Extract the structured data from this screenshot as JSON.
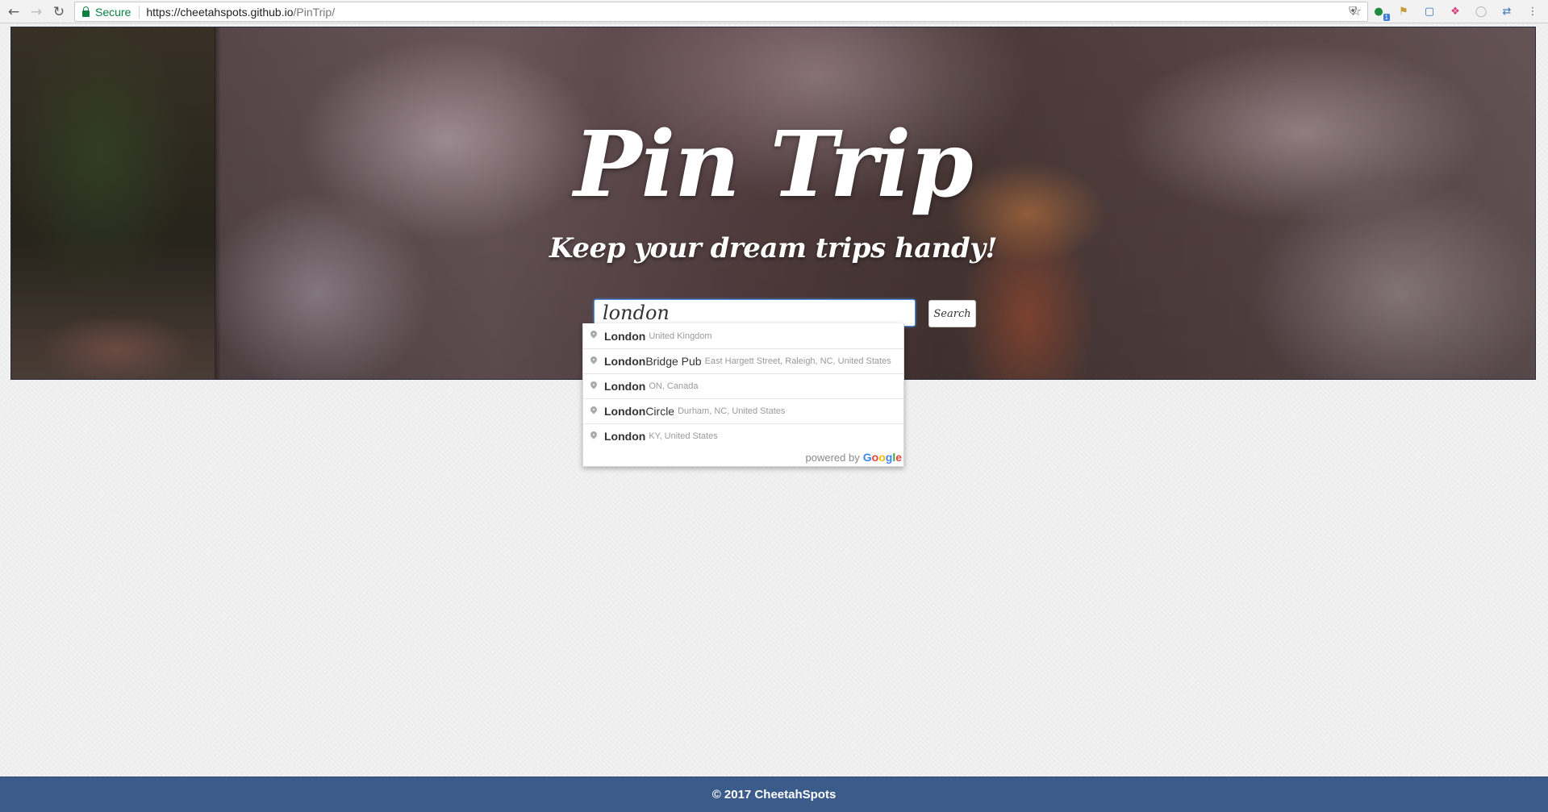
{
  "browser": {
    "secure_label": "Secure",
    "url_host": "https://cheetahspots.github.io",
    "url_path": "/PinTrip/",
    "extension_badge": "1"
  },
  "hero": {
    "title": "Pin Trip",
    "subtitle": "Keep your dream trips handy!"
  },
  "search": {
    "value": "london",
    "button_label": "Search"
  },
  "autocomplete": {
    "items": [
      {
        "match": "London",
        "rest": "",
        "secondary": "United Kingdom"
      },
      {
        "match": "London",
        "rest": " Bridge Pub",
        "secondary": "East Hargett Street, Raleigh, NC, United States"
      },
      {
        "match": "London",
        "rest": "",
        "secondary": "ON, Canada"
      },
      {
        "match": "London",
        "rest": " Circle",
        "secondary": "Durham, NC, United States"
      },
      {
        "match": "London",
        "rest": "",
        "secondary": "KY, United States"
      }
    ],
    "powered_by": "powered by",
    "google_letters": [
      "G",
      "o",
      "o",
      "g",
      "l",
      "e"
    ]
  },
  "footer": {
    "copyright": "© 2017 CheetahSpots"
  },
  "colors": {
    "footer_bg": "#3b5b8b",
    "secure_green": "#0b8043",
    "focus_blue": "#4a90e2"
  }
}
